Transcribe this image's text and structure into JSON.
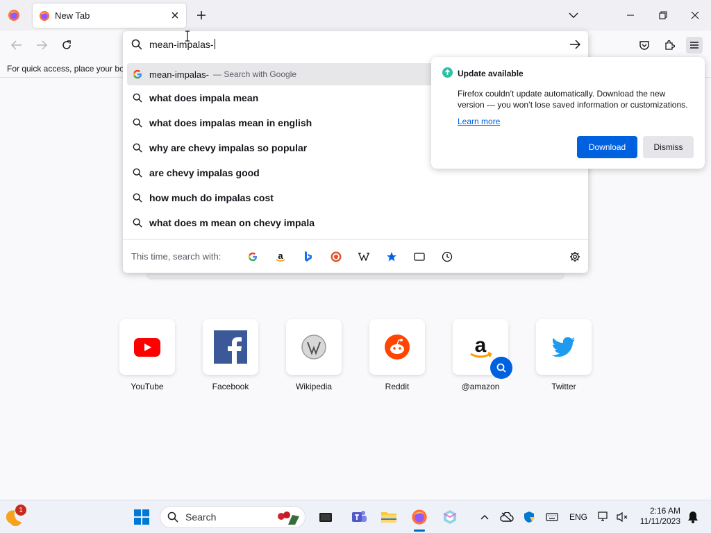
{
  "browser": {
    "tab": {
      "title": "New Tab"
    },
    "bookmarks_hint": "For quick access, place your boo",
    "urlbar": {
      "value": "mean-impalas-",
      "results": [
        {
          "text": "mean-impalas-",
          "suffix": "— Search with Google",
          "icon": "google-icon"
        },
        {
          "text": "what does impala mean",
          "icon": "search-icon"
        },
        {
          "text": "what does impalas mean in english",
          "icon": "search-icon"
        },
        {
          "text": "why are chevy impalas so popular",
          "icon": "search-icon"
        },
        {
          "text": "are chevy impalas good",
          "icon": "search-icon"
        },
        {
          "text": "how much do impalas cost",
          "icon": "search-icon"
        },
        {
          "text": "what does m mean on chevy impala",
          "icon": "search-icon"
        }
      ],
      "oneoff_label": "This time, search with:",
      "engines": [
        "google-icon",
        "amazon-icon",
        "bing-icon",
        "duckduckgo-icon",
        "wikipedia-icon",
        "bookmarks-icon",
        "tabs-icon",
        "history-icon"
      ]
    },
    "update_panel": {
      "title": "Update available",
      "body": "Firefox couldn’t update automatically. Download the new version — you won’t lose saved information or customizations.",
      "learn_more": "Learn more",
      "download_label": "Download",
      "dismiss_label": "Dismiss",
      "accent": "#0061e0"
    }
  },
  "top_sites": [
    {
      "label": "YouTube",
      "icon": "youtube-icon"
    },
    {
      "label": "Facebook",
      "icon": "facebook-icon"
    },
    {
      "label": "Wikipedia",
      "icon": "wikipedia-icon"
    },
    {
      "label": "Reddit",
      "icon": "reddit-icon"
    },
    {
      "label": "@amazon",
      "icon": "amazon-icon"
    },
    {
      "label": "Twitter",
      "icon": "twitter-icon"
    }
  ],
  "taskbar": {
    "search_label": "Search",
    "notification_count": "1",
    "language": "ENG",
    "time": "2:16 AM",
    "date": "11/11/2023"
  }
}
